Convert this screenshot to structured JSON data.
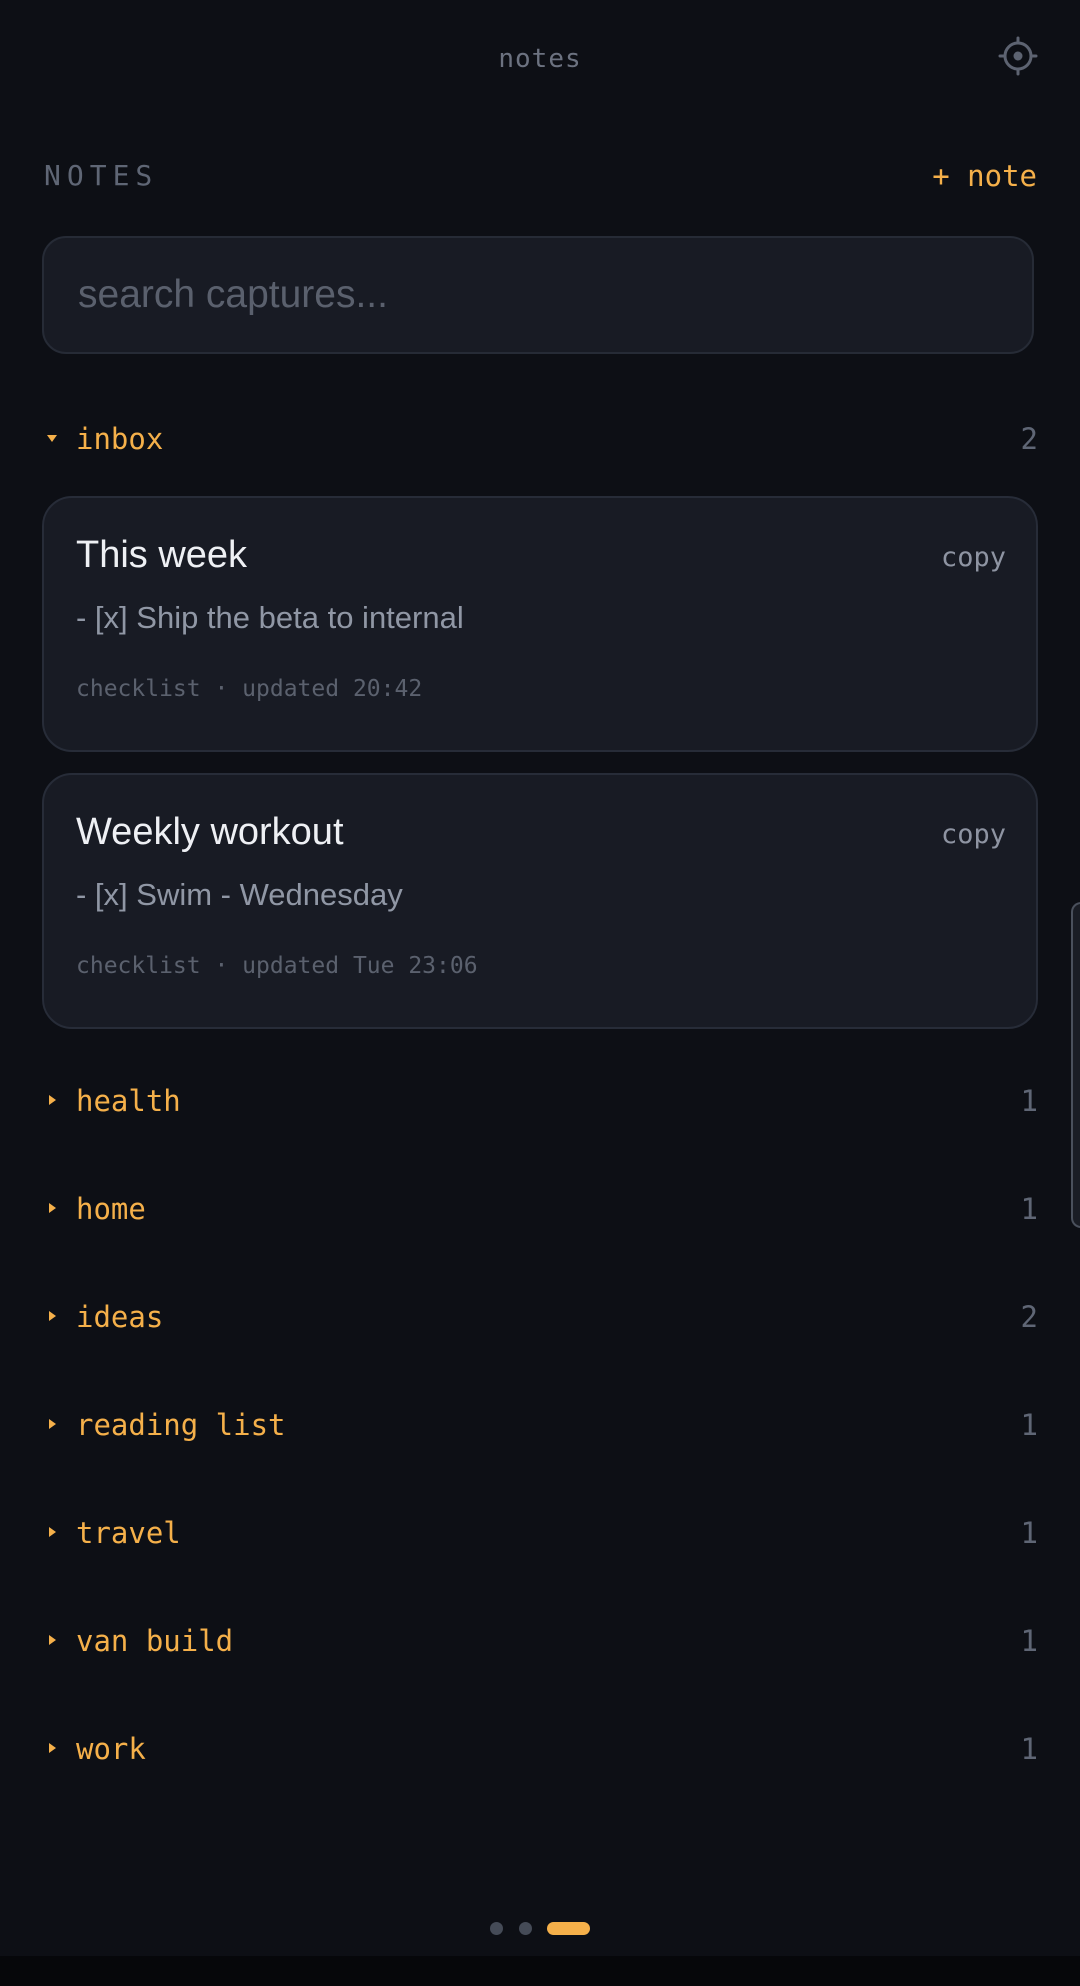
{
  "header": {
    "app_title": "notes",
    "settings_icon": "gear-icon"
  },
  "section": {
    "title": "NOTES",
    "new_note_label": "+ note"
  },
  "search": {
    "placeholder": "search captures...",
    "value": ""
  },
  "groups": [
    {
      "name": "inbox",
      "count": "2",
      "expanded": true,
      "caret_icon": "caret-down-icon",
      "notes": [
        {
          "title": "This week",
          "copy_label": "copy",
          "preview": "- [x] Ship the beta to internal",
          "meta": "checklist · updated 20:42"
        },
        {
          "title": "Weekly workout",
          "copy_label": "copy",
          "preview": "- [x] Swim - Wednesday",
          "meta": "checklist · updated Tue 23:06"
        }
      ]
    },
    {
      "name": "health",
      "count": "1",
      "expanded": false,
      "caret_icon": "caret-right-icon"
    },
    {
      "name": "home",
      "count": "1",
      "expanded": false,
      "caret_icon": "caret-right-icon"
    },
    {
      "name": "ideas",
      "count": "2",
      "expanded": false,
      "caret_icon": "caret-right-icon"
    },
    {
      "name": "reading list",
      "count": "1",
      "expanded": false,
      "caret_icon": "caret-right-icon"
    },
    {
      "name": "travel",
      "count": "1",
      "expanded": false,
      "caret_icon": "caret-right-icon"
    },
    {
      "name": "van build",
      "count": "1",
      "expanded": false,
      "caret_icon": "caret-right-icon"
    },
    {
      "name": "work",
      "count": "1",
      "expanded": false,
      "caret_icon": "caret-right-icon"
    }
  ],
  "pager": {
    "page_count": 3,
    "active_page": 3
  },
  "colors": {
    "background": "#0d0f15",
    "card": "#181b24",
    "accent": "#f5b04a",
    "muted": "#5f6675"
  }
}
